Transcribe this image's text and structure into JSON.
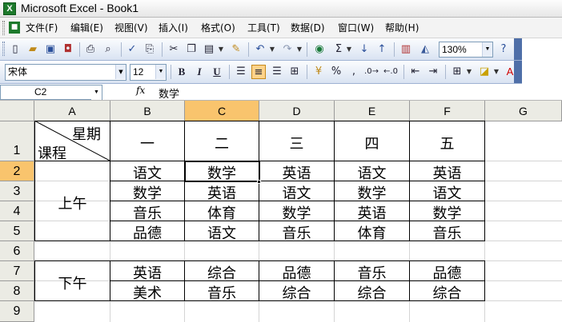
{
  "window": {
    "title": "Microsoft Excel - Book1",
    "app_icon_glyph": "X"
  },
  "menu": [
    "文件(F)",
    "编辑(E)",
    "视图(V)",
    "插入(I)",
    "格式(O)",
    "工具(T)",
    "数据(D)",
    "窗口(W)",
    "帮助(H)"
  ],
  "standard_toolbar": {
    "zoom": "130%"
  },
  "format_toolbar": {
    "font_name": "宋体",
    "font_size": "12",
    "bold": "B",
    "italic": "I",
    "underline": "U"
  },
  "formula_bar": {
    "name_box": "C2",
    "fx": "fx",
    "content": "数学"
  },
  "columns": [
    "A",
    "B",
    "C",
    "D",
    "E",
    "F",
    "G"
  ],
  "rows": [
    "1",
    "2",
    "3",
    "4",
    "5",
    "6",
    "7",
    "8",
    "9"
  ],
  "selected": {
    "column": "C",
    "row": "2"
  },
  "sheet": {
    "header": {
      "weekday_label": "星期",
      "course_label": "课程",
      "days": [
        "一",
        "二",
        "三",
        "四",
        "五"
      ]
    },
    "morning": {
      "label": "上午",
      "rows": [
        [
          "语文",
          "数学",
          "英语",
          "语文",
          "英语"
        ],
        [
          "数学",
          "英语",
          "语文",
          "数学",
          "语文"
        ],
        [
          "音乐",
          "体育",
          "数学",
          "英语",
          "数学"
        ],
        [
          "品德",
          "语文",
          "音乐",
          "体育",
          "音乐"
        ]
      ]
    },
    "afternoon": {
      "label": "下午",
      "rows": [
        [
          "英语",
          "综合",
          "品德",
          "音乐",
          "品德"
        ],
        [
          "美术",
          "音乐",
          "综合",
          "综合",
          "综合"
        ]
      ]
    }
  },
  "colors": {
    "selection_header": "#f9c46d",
    "toolbar_end": "#4f6fa8"
  }
}
